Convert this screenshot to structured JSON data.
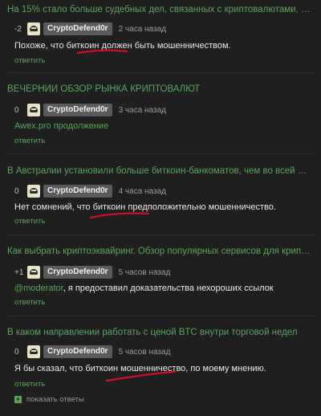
{
  "items": [
    {
      "title": "На 15% стало больше судебных дел, связанных с криптовалютами, в России",
      "score": "-2",
      "author": "CryptoDefend0r",
      "time": "2 часа назад",
      "text": "Похоже, что биткоин должен быть мошенничеством.",
      "reply": "ответить"
    },
    {
      "title": "ВЕЧЕРНИЙ ОБЗОР РЫНКА КРИПТОВАЛЮТ",
      "score": "0",
      "author": "CryptoDefend0r",
      "time": "3 часа назад",
      "text": "Awex.pro продолжение",
      "reply": "ответить"
    },
    {
      "title": "В Австралии установили больше биткоин-банкоматов, чем во всей Азии",
      "score": "0",
      "author": "CryptoDefend0r",
      "time": "4 часа назад",
      "text": "Нет сомнений, что биткоин предположительно мошенничество.",
      "reply": "ответить"
    },
    {
      "title": "Как выбрать криптоэквайринг. Обзор популярных сервисов для криптоплатежей",
      "score": "+1",
      "author": "CryptoDefend0r",
      "time": "5 часов назад",
      "text_link": "@moderator",
      "text": ", я предоставил доказательства нехороших ссылок",
      "reply": "ответить"
    },
    {
      "title": "В каком направлении работать с ценой BTC внутри торговой недел",
      "score": "0",
      "author": "CryptoDefend0r",
      "time": "5 часов назад",
      "text": "Я бы сказал, что биткоин мошенничество, по моему мнению.",
      "reply": "ответить",
      "show_replies": "показать ответы"
    }
  ],
  "colors": {
    "link": "#5aa55a",
    "background": "#1f1f1f",
    "underline": "#d0102a"
  }
}
